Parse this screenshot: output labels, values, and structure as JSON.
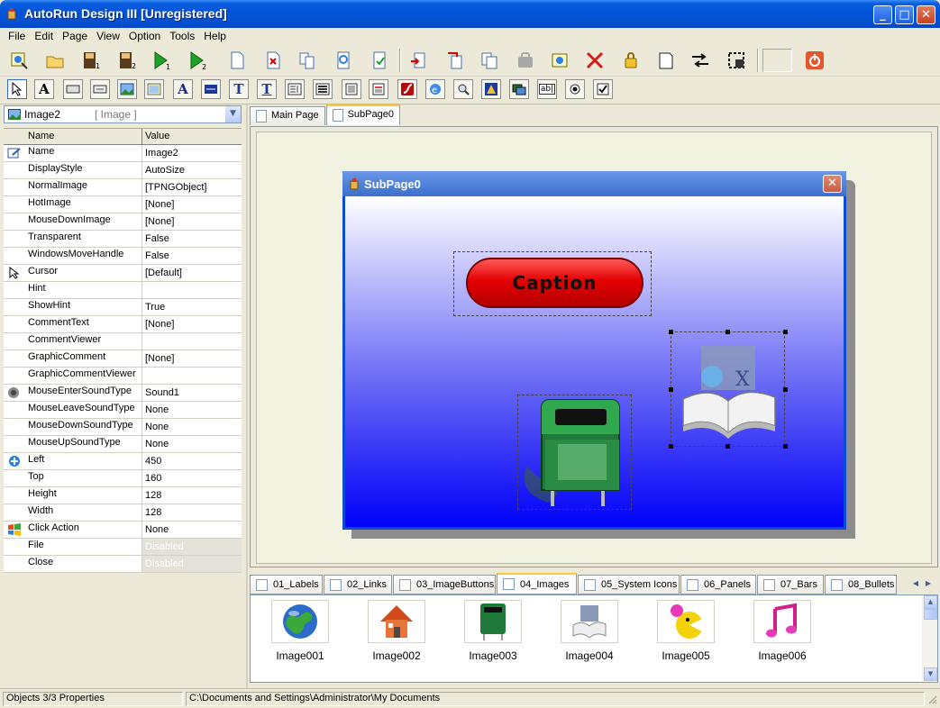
{
  "window": {
    "title": "AutoRun Design III [Unregistered]",
    "minimize": "_",
    "maximize": "□",
    "close": "✕"
  },
  "menu": [
    "File",
    "Edit",
    "Page",
    "View",
    "Option",
    "Tools",
    "Help"
  ],
  "toolbar_main": {
    "icons": [
      "open-wizard-icon",
      "open-folder-icon",
      "save-1-icon",
      "save-2-icon",
      "run-1-icon",
      "run-2-icon",
      "new-page-icon",
      "delete-page-icon",
      "copy-page-icon",
      "preview-icon",
      "export-icon",
      "import-icon",
      "duplicate-icon",
      "clipboard-icon",
      "lock-disabled-icon",
      "settings-icon",
      "delete-icon",
      "lock-icon",
      "blank-icon",
      "align-icon",
      "select-region-icon",
      "power-icon"
    ],
    "run_labels": [
      "1",
      "2"
    ]
  },
  "toolbar_objects": {
    "icons": [
      "pointer-tool",
      "label-tool",
      "panel-tool",
      "button-tool",
      "image-tool",
      "gradient-tool",
      "text-tool",
      "link-tool",
      "caption-tool",
      "rich-text-tool",
      "memo-tool",
      "list-tool",
      "document-tool",
      "form-tool",
      "flash-tool",
      "browser-tool",
      "magnifier-tool",
      "shape-tool",
      "media-tool",
      "edit-tool",
      "radio-tool",
      "checkbox-tool"
    ],
    "text_glyphs": {
      "label": "A",
      "text": "T",
      "edit": "ab|"
    }
  },
  "object_selector": {
    "name": "Image2",
    "type": "[ Image ]"
  },
  "properties": {
    "headers": [
      "Name",
      "Value"
    ],
    "rows": [
      {
        "name": "Name",
        "value": "Image2",
        "icon": "name-edit-icon"
      },
      {
        "name": "DisplayStyle",
        "value": "AutoSize",
        "icon": ""
      },
      {
        "name": "NormalImage",
        "value": "[TPNGObject]",
        "icon": ""
      },
      {
        "name": "HotImage",
        "value": "[None]",
        "icon": ""
      },
      {
        "name": "MouseDownImage",
        "value": "[None]",
        "icon": ""
      },
      {
        "name": "Transparent",
        "value": "False",
        "icon": ""
      },
      {
        "name": "WindowsMoveHandle",
        "value": "False",
        "icon": ""
      },
      {
        "name": "Cursor",
        "value": "[Default]",
        "icon": "cursor-icon"
      },
      {
        "name": "Hint",
        "value": "",
        "icon": ""
      },
      {
        "name": "ShowHint",
        "value": "True",
        "icon": ""
      },
      {
        "name": "CommentText",
        "value": "[None]",
        "icon": ""
      },
      {
        "name": "CommentViewer",
        "value": "",
        "icon": ""
      },
      {
        "name": "GraphicComment",
        "value": "[None]",
        "icon": ""
      },
      {
        "name": "GraphicCommentViewer",
        "value": "",
        "icon": ""
      },
      {
        "name": "MouseEnterSoundType",
        "value": "Sound1",
        "icon": "speaker-icon"
      },
      {
        "name": "MouseLeaveSoundType",
        "value": "None",
        "icon": ""
      },
      {
        "name": "MouseDownSoundType",
        "value": "None",
        "icon": ""
      },
      {
        "name": "MouseUpSoundType",
        "value": "None",
        "icon": ""
      },
      {
        "name": "Left",
        "value": "450",
        "icon": "position-icon"
      },
      {
        "name": "Top",
        "value": "160",
        "icon": ""
      },
      {
        "name": "Height",
        "value": "128",
        "icon": ""
      },
      {
        "name": "Width",
        "value": "128",
        "icon": ""
      },
      {
        "name": "Click Action",
        "value": "None",
        "icon": "windows-logo-icon"
      },
      {
        "name": "File",
        "value": "Disabled",
        "icon": "",
        "disabled": true
      },
      {
        "name": "Close",
        "value": "Disabled",
        "icon": "",
        "disabled": true
      }
    ]
  },
  "page_tabs": [
    {
      "label": "Main Page",
      "active": false
    },
    {
      "label": "SubPage0",
      "active": true
    }
  ],
  "subpage": {
    "title": "SubPage0",
    "caption_button": "Caption"
  },
  "library_tabs": [
    {
      "label": "01_Labels",
      "active": false
    },
    {
      "label": "02_Links",
      "active": false
    },
    {
      "label": "03_ImageButtons",
      "active": false
    },
    {
      "label": "04_Images",
      "active": true
    },
    {
      "label": "05_System Icons",
      "active": false
    },
    {
      "label": "06_Panels",
      "active": false
    },
    {
      "label": "07_Bars",
      "active": false
    },
    {
      "label": "08_Bullets",
      "active": false
    }
  ],
  "gallery": [
    {
      "label": "Image001",
      "icon": "globe-icon"
    },
    {
      "label": "Image002",
      "icon": "house-icon"
    },
    {
      "label": "Image003",
      "icon": "trash-bin-icon"
    },
    {
      "label": "Image004",
      "icon": "book-icon"
    },
    {
      "label": "Image005",
      "icon": "pacman-icon"
    },
    {
      "label": "Image006",
      "icon": "music-note-icon"
    }
  ],
  "status": {
    "left": "Objects 3/3 Properties",
    "path": "C:\\Documents and Settings\\Administrator\\My Documents"
  },
  "colors": {
    "titlebar": "#0454d8",
    "subpage_gradient_top": "#ffffff",
    "subpage_gradient_bottom": "#0000f8",
    "caption_button": "#e40000",
    "tab_highlight": "#ffc83c"
  }
}
